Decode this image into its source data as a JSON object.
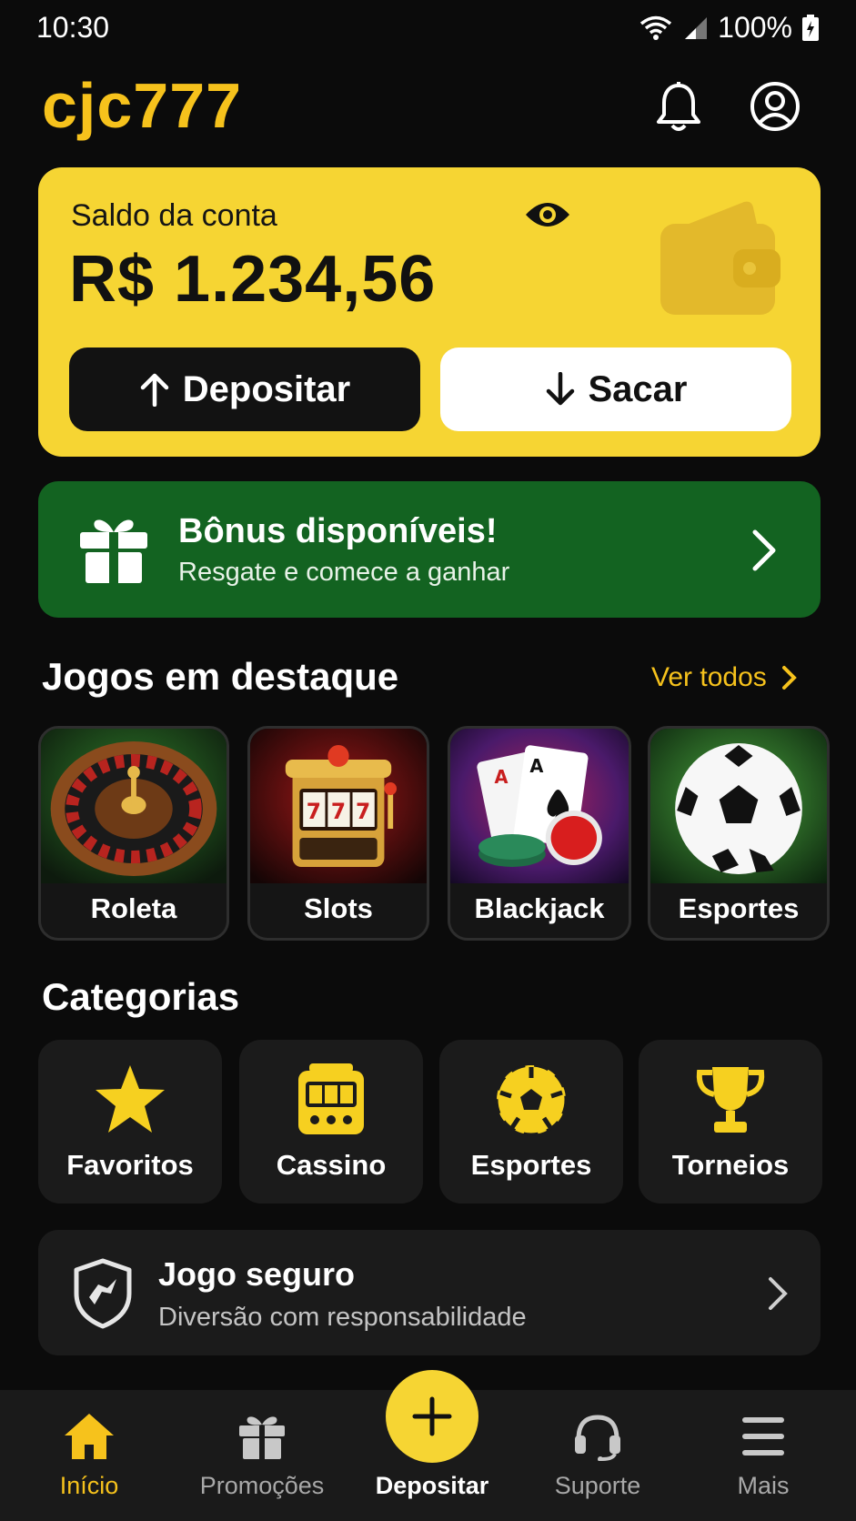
{
  "status_bar": {
    "time": "10:30",
    "battery": "100%"
  },
  "header": {
    "logo": "cjc777"
  },
  "balance": {
    "label": "Saldo da conta",
    "amount": "R$ 1.234,56",
    "deposit_label": "Depositar",
    "withdraw_label": "Sacar"
  },
  "bonus": {
    "title": "Bônus disponíveis!",
    "subtitle": "Resgate e comece a ganhar"
  },
  "featured": {
    "title": "Jogos em destaque",
    "see_all": "Ver todos",
    "games": [
      {
        "label": "Roleta",
        "icon": "roulette-icon"
      },
      {
        "label": "Slots",
        "icon": "slot-machine-icon"
      },
      {
        "label": "Blackjack",
        "icon": "cards-icon"
      },
      {
        "label": "Esportes",
        "icon": "soccer-ball-icon"
      }
    ]
  },
  "categories": {
    "title": "Categorias",
    "items": [
      {
        "label": "Favoritos",
        "icon": "star-icon"
      },
      {
        "label": "Cassino",
        "icon": "slot-machine-icon"
      },
      {
        "label": "Esportes",
        "icon": "soccer-ball-icon"
      },
      {
        "label": "Torneios",
        "icon": "trophy-icon"
      }
    ]
  },
  "safe_play": {
    "title": "Jogo seguro",
    "subtitle": "Diversão com responsabilidade"
  },
  "bottom_nav": {
    "items": [
      {
        "label": "Início",
        "icon": "home-icon",
        "active": true
      },
      {
        "label": "Promoções",
        "icon": "gift-icon",
        "active": false
      },
      {
        "label": "Depositar",
        "icon": "plus-icon",
        "active": false
      },
      {
        "label": "Suporte",
        "icon": "headset-icon",
        "active": false
      },
      {
        "label": "Mais",
        "icon": "menu-icon",
        "active": false
      }
    ]
  },
  "colors": {
    "background": "#0b0b0b",
    "accent": "#f6c21c",
    "card_yellow": "#f6d533",
    "bonus_green": "#136321",
    "surface": "#1b1b1b"
  }
}
